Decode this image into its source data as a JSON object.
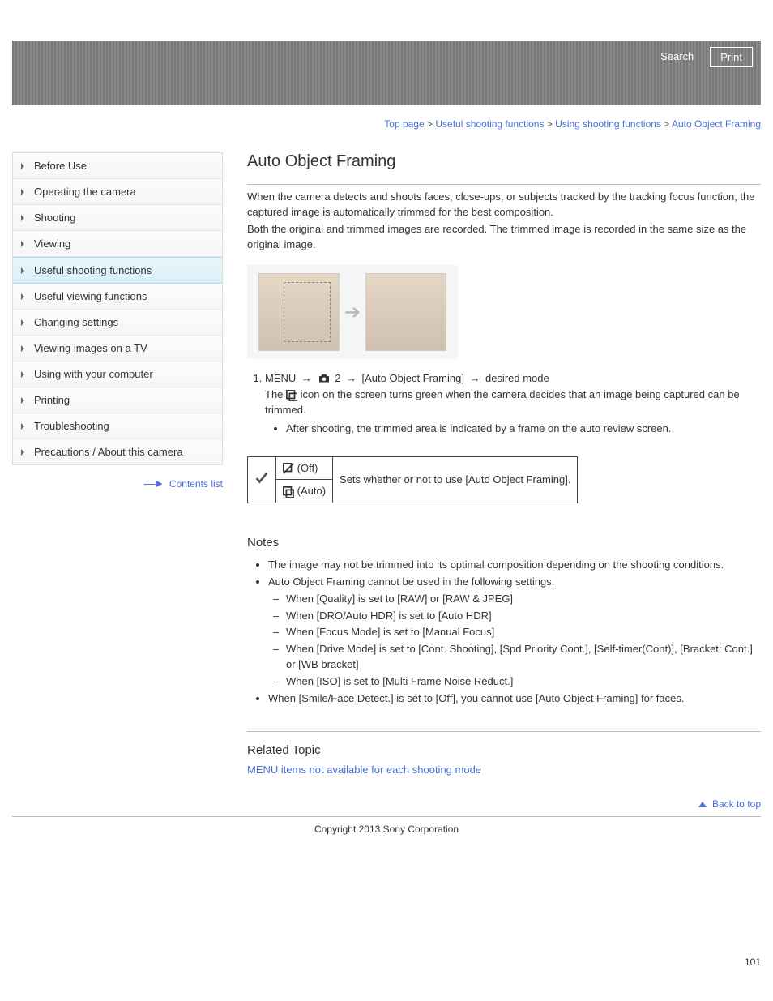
{
  "header": {
    "search_label": "Search",
    "print_label": "Print"
  },
  "breadcrumb": {
    "items": [
      {
        "label": "Top page"
      },
      {
        "label": "Useful shooting functions"
      },
      {
        "label": "Using shooting functions"
      }
    ],
    "current": "Auto Object Framing",
    "sep": ">"
  },
  "sidebar": {
    "items": [
      {
        "label": "Before Use"
      },
      {
        "label": "Operating the camera"
      },
      {
        "label": "Shooting"
      },
      {
        "label": "Viewing"
      },
      {
        "label": "Useful shooting functions",
        "active": true
      },
      {
        "label": "Useful viewing functions"
      },
      {
        "label": "Changing settings"
      },
      {
        "label": "Viewing images on a TV"
      },
      {
        "label": "Using with your computer"
      },
      {
        "label": "Printing"
      },
      {
        "label": "Troubleshooting"
      },
      {
        "label": "Precautions / About this camera"
      }
    ],
    "contents_list_label": "Contents list"
  },
  "article": {
    "title": "Auto Object Framing",
    "intro1": "When the camera detects and shoots faces, close-ups, or subjects tracked by the tracking focus function, the captured image is automatically trimmed for the best composition.",
    "intro2": "Both the original and trimmed images are recorded. The trimmed image is recorded in the same size as the original image.",
    "menu_path": {
      "menu_label": "MENU",
      "page_num": "2",
      "item_label": "[Auto Object Framing]",
      "desired_mode_label": "desired mode",
      "arrow_glyph": "→"
    },
    "icon_note_prefix": "The",
    "icon_note_suffix": "icon on the screen turns green when the camera decides that an image being captured can be trimmed.",
    "after_shooting": "After shooting, the trimmed area is indicated by a frame on the auto review screen.",
    "options": {
      "off_label": "(Off)",
      "auto_label": "(Auto)",
      "desc": "Sets whether or not to use [Auto Object Framing]."
    },
    "notes": {
      "heading": "Notes",
      "items": [
        "The image may not be trimmed into its optimal composition depending on the shooting conditions.",
        "Auto Object Framing cannot be used in the following settings."
      ],
      "sub_items": [
        "When [Quality] is set to [RAW] or [RAW & JPEG]",
        "When [DRO/Auto HDR] is set to [Auto HDR]",
        "When [Focus Mode] is set to [Manual Focus]",
        "When [Drive Mode] is set to [Cont. Shooting], [Spd Priority Cont.], [Self-timer(Cont)], [Bracket: Cont.] or [WB bracket]",
        "When [ISO] is set to [Multi Frame Noise Reduct.]"
      ],
      "items_after": [
        "When [Smile/Face Detect.] is set to [Off], you cannot use [Auto Object Framing] for faces."
      ]
    },
    "related": {
      "heading": "Related Topic",
      "link": "MENU items not available for each shooting mode"
    }
  },
  "footer": {
    "back_to_top": "Back to top",
    "copyright": "Copyright 2013 Sony Corporation",
    "page_number": "101"
  }
}
